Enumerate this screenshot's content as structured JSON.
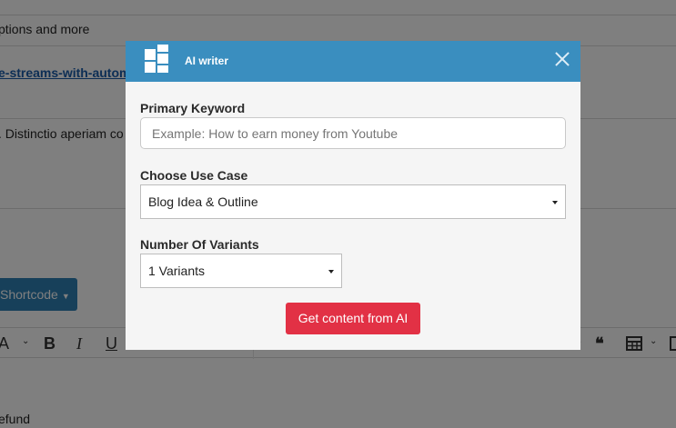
{
  "background": {
    "line1_text": "ptions and more",
    "link_text": "e-streams-with-automa",
    "line3_text": ". Distinctio aperiam co",
    "shortcode_label": "Shortcode",
    "refund_text": "efund",
    "toolbar": {
      "font_icon": "A",
      "bold": "B",
      "italic": "I",
      "underline": "U"
    }
  },
  "modal": {
    "title": "AI writer",
    "primary_keyword": {
      "label": "Primary Keyword",
      "placeholder": "Example: How to earn money from Youtube",
      "value": ""
    },
    "use_case": {
      "label": "Choose Use Case",
      "selected": "Blog Idea & Outline"
    },
    "variants": {
      "label": "Number Of Variants",
      "selected": "1 Variants"
    },
    "submit_label": "Get content from AI"
  },
  "colors": {
    "header": "#3a8ebf",
    "submit": "#e23145",
    "shortcode": "#2f80b5"
  },
  "icons": [
    "grid-logo-icon",
    "close-icon",
    "chevron-down-icon",
    "quote-icon",
    "table-icon"
  ]
}
